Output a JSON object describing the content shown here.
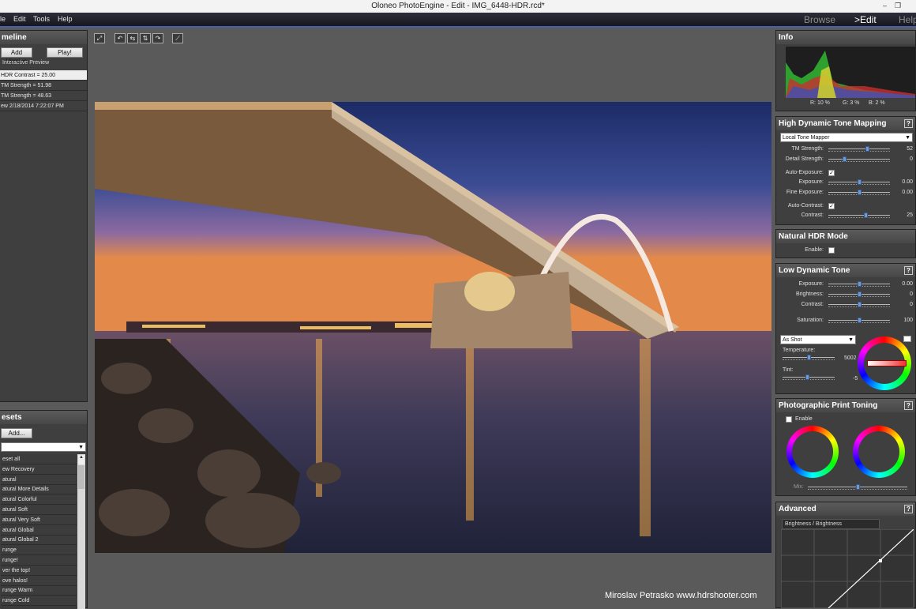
{
  "title": "Oloneo PhotoEngine - Edit - IMG_6448-HDR.rcd*",
  "window_controls": {
    "minimize": "–",
    "restore": "❐"
  },
  "menu": [
    "le",
    "Edit",
    "Tools",
    "Help"
  ],
  "nav": {
    "browse": "Browse",
    "edit": ">Edit",
    "help": "Help"
  },
  "toolbar_icons": [
    "fit-screen-icon",
    "rotate-left-icon",
    "flip-horizontal-icon",
    "flip-vertical-icon",
    "rotate-right-icon",
    "crop-icon"
  ],
  "timeline": {
    "title": "meline",
    "add_version": "Add Version",
    "play": "Play!",
    "interactive_preview": "Interactive Preview",
    "items": [
      "HDR Contrast = 25.00",
      "TM Strength = 51.98",
      "TM Strength = 48.63",
      "ew 2/18/2014 7:22:07 PM"
    ]
  },
  "presets": {
    "title": "esets",
    "add": "Add...",
    "items": [
      "eset all",
      "ew Recovery",
      "atural",
      "atural More Details",
      "atural Colorful",
      "atural Soft",
      "atural Very Soft",
      "atural Global",
      "atural Global 2",
      "runge",
      "runge!",
      "ver the top!",
      "ove halos!",
      "runge Warm",
      "runge Cold"
    ]
  },
  "info": {
    "title": "Info",
    "r": "R: 10 %",
    "g": "G: 3 %",
    "b": "B: 2 %"
  },
  "hdtm": {
    "title": "High Dynamic Tone Mapping",
    "help": "?",
    "mode": "Local Tone Mapper",
    "tm_strength_label": "TM Strength:",
    "tm_strength": "52",
    "detail_strength_label": "Detail Strength:",
    "detail_strength": "0",
    "auto_exposure_label": "Auto-Exposure:",
    "exposure_label": "Exposure:",
    "exposure": "0.00",
    "fine_exposure_label": "Fine Exposure:",
    "fine_exposure": "0.00",
    "auto_contrast_label": "Auto-Contrast:",
    "contrast_label": "Contrast:",
    "contrast": "25"
  },
  "nhdr": {
    "title": "Natural HDR Mode",
    "enable_label": "Enable:"
  },
  "ldt": {
    "title": "Low Dynamic Tone",
    "help": "?",
    "exposure_label": "Exposure:",
    "exposure": "0.00",
    "brightness_label": "Brightness:",
    "brightness": "0",
    "contrast_label": "Contrast:",
    "contrast": "0",
    "saturation_label": "Saturation:",
    "saturation": "100",
    "wb_mode": "As Shot",
    "temperature_label": "Temperature:",
    "temperature": "5002",
    "tint_label": "Tint:",
    "tint": "-5"
  },
  "ppt": {
    "title": "Photographic Print Toning",
    "help": "?",
    "enable_label": "Enable",
    "mix_label": "Mix:"
  },
  "advanced": {
    "title": "Advanced",
    "help": "?",
    "curve_label": "Brightness / Brightness"
  },
  "watermark": "Miroslav  Petrasko  www.hdrshooter.com",
  "slider_levels": {
    "tm_strength": 0.64,
    "detail_strength": 0.25,
    "exposure": 0.5,
    "fine_exposure": 0.5,
    "contrast": 0.62,
    "ldt_exposure": 0.5,
    "ldt_brightness": 0.5,
    "ldt_contrast": 0.5,
    "saturation": 0.5,
    "temperature": 0.5,
    "tint": 0.48,
    "mix": 0.5
  }
}
